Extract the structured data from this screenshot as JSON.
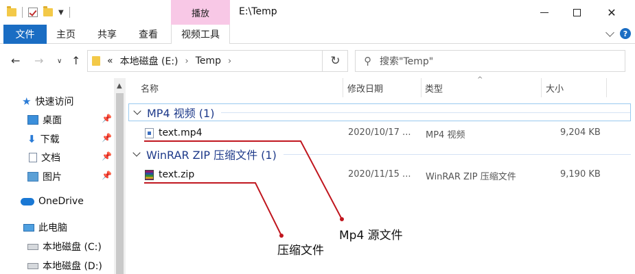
{
  "window": {
    "title": "E:\\Temp",
    "context_tab_header": "播放"
  },
  "ribbon": {
    "tabs": [
      "文件",
      "主页",
      "共享",
      "查看",
      "视频工具"
    ]
  },
  "nav": {
    "back_icon": "←",
    "forward_icon": "→",
    "recent_icon": "∨",
    "up_icon": "↑",
    "address": {
      "overflow": "«",
      "crumbs": [
        "本地磁盘 (E:)",
        "Temp"
      ],
      "separator": "›"
    },
    "refresh_icon": "↻",
    "search_placeholder": "搜索\"Temp\"",
    "search_icon": "⚲"
  },
  "sidebar": {
    "items": [
      {
        "label": "快速访问",
        "icon": "star-icon",
        "pinned": false
      },
      {
        "label": "桌面",
        "icon": "desktop-icon",
        "pinned": true
      },
      {
        "label": "下载",
        "icon": "download-icon",
        "pinned": true
      },
      {
        "label": "文档",
        "icon": "document-icon",
        "pinned": true
      },
      {
        "label": "图片",
        "icon": "pictures-icon",
        "pinned": true
      },
      {
        "label": "OneDrive",
        "icon": "cloud-icon",
        "pinned": false
      },
      {
        "label": "此电脑",
        "icon": "computer-icon",
        "pinned": false
      },
      {
        "label": "本地磁盘 (C:)",
        "icon": "drive-icon",
        "pinned": false
      },
      {
        "label": "本地磁盘 (D:)",
        "icon": "drive-icon",
        "pinned": false
      }
    ],
    "pin_glyph": "📌"
  },
  "columns": {
    "name": "名称",
    "modified": "修改日期",
    "type": "类型",
    "size": "大小",
    "sort_indicator": "^"
  },
  "groups": [
    {
      "label": "MP4 视频 (1)",
      "files": [
        {
          "name": "text.mp4",
          "modified": "2020/10/17 ...",
          "type": "MP4 视频",
          "size": "9,204 KB",
          "icon": "mp4-file-icon"
        }
      ]
    },
    {
      "label": "WinRAR ZIP 压缩文件 (1)",
      "files": [
        {
          "name": "text.zip",
          "modified": "2020/11/15 ...",
          "type": "WinRAR ZIP 压缩文件",
          "size": "9,190 KB",
          "icon": "winrar-zip-icon"
        }
      ]
    }
  ],
  "annotations": {
    "mp4_label": "Mp4 源文件",
    "zip_label": "压缩文件",
    "line_color": "#c0161e"
  }
}
